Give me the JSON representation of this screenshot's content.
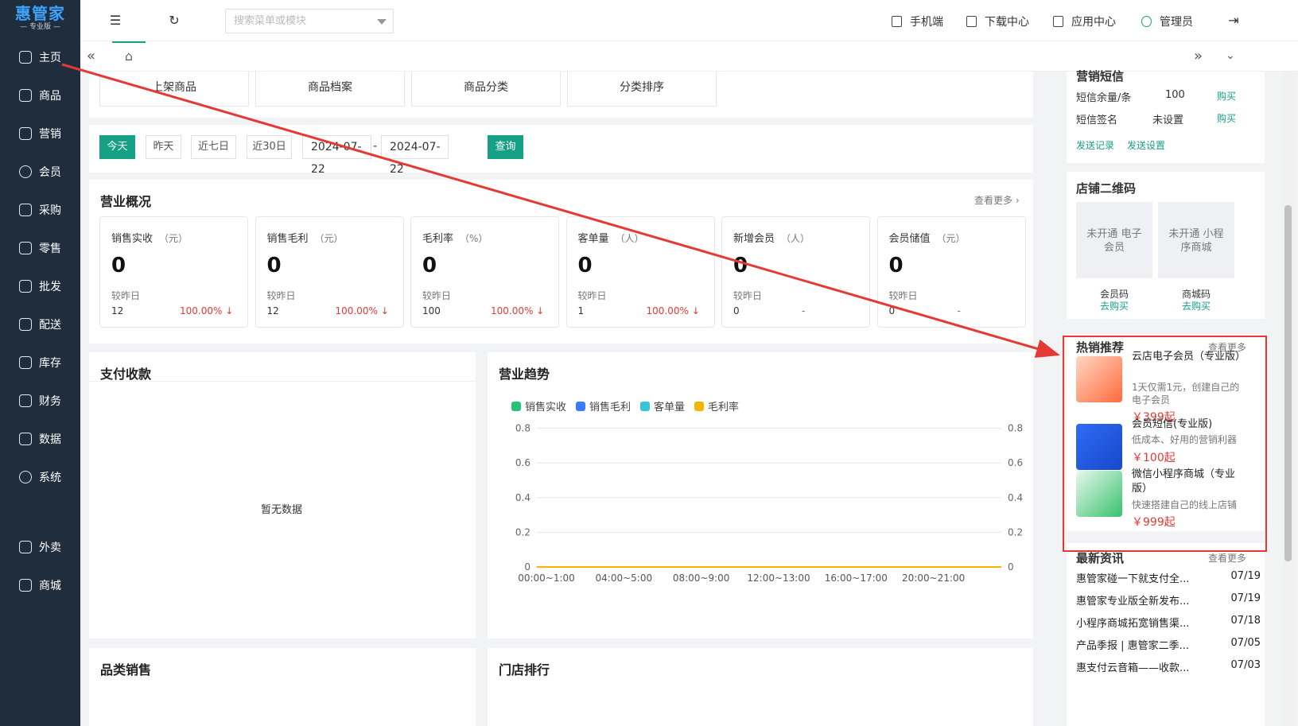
{
  "sidebar": {
    "logo_main": "惠管家",
    "logo_sub": "专业版",
    "items": [
      {
        "label": "主页",
        "icon": "home-icon"
      },
      {
        "label": "商品",
        "icon": "box-icon"
      },
      {
        "label": "营销",
        "icon": "chart-icon"
      },
      {
        "label": "会员",
        "icon": "diamond-icon"
      },
      {
        "label": "采购",
        "icon": "cart-icon"
      },
      {
        "label": "零售",
        "icon": "bag-icon"
      },
      {
        "label": "批发",
        "icon": "building-icon"
      },
      {
        "label": "配送",
        "icon": "truck-icon"
      },
      {
        "label": "库存",
        "icon": "inventory-icon"
      },
      {
        "label": "财务",
        "icon": "finance-icon"
      },
      {
        "label": "数据",
        "icon": "data-icon"
      },
      {
        "label": "系统",
        "icon": "settings-icon"
      },
      {
        "label": "外卖",
        "icon": "delivery-icon"
      },
      {
        "label": "商城",
        "icon": "store-icon"
      }
    ]
  },
  "topbar": {
    "search_placeholder": "搜索菜单或模块",
    "mobile": "手机端",
    "download": "下载中心",
    "apps": "应用中心",
    "user": "管理员"
  },
  "quick_buttons": [
    "上架商品",
    "商品档案",
    "商品分类",
    "分类排序"
  ],
  "filters": {
    "today": "今天",
    "yesterday": "昨天",
    "last7": "近七日",
    "last30": "近30日",
    "start_date": "2024-07-22",
    "separator": "-",
    "end_date": "2024-07-22",
    "query": "查询"
  },
  "overview": {
    "title": "营业概况",
    "more": "查看更多 ›",
    "compare_label": "较昨日",
    "stats": [
      {
        "name": "销售实收",
        "unit": "（元）",
        "value": "0",
        "yesterday": "12",
        "change": "100.00% ↓"
      },
      {
        "name": "销售毛利",
        "unit": "（元）",
        "value": "0",
        "yesterday": "12",
        "change": "100.00% ↓"
      },
      {
        "name": "毛利率",
        "unit": "（%）",
        "value": "0",
        "yesterday": "100",
        "change": "100.00% ↓"
      },
      {
        "name": "客单量",
        "unit": "（人）",
        "value": "0",
        "yesterday": "1",
        "change": "100.00% ↓"
      },
      {
        "name": "新增会员",
        "unit": "（人）",
        "value": "0",
        "yesterday": "0",
        "change": "-"
      },
      {
        "name": "会员储值",
        "unit": "（元）",
        "value": "0",
        "yesterday": "0",
        "change": "-"
      }
    ]
  },
  "payment": {
    "title": "支付收款",
    "empty": "暂无数据"
  },
  "trend": {
    "title": "营业趋势"
  },
  "category_sales": {
    "title": "品类销售"
  },
  "store_rank": {
    "title": "门店排行"
  },
  "chart_data": {
    "type": "line",
    "x": [
      "00:00~1:00",
      "04:00~5:00",
      "08:00~9:00",
      "12:00~13:00",
      "16:00~17:00",
      "20:00~21:00"
    ],
    "series": [
      {
        "name": "销售实收",
        "color": "#27c27a",
        "values": [
          0,
          0,
          0,
          0,
          0,
          0
        ]
      },
      {
        "name": "销售毛利",
        "color": "#3a7bff",
        "values": [
          0,
          0,
          0,
          0,
          0,
          0
        ]
      },
      {
        "name": "客单量",
        "color": "#36c4d8",
        "values": [
          0,
          0,
          0,
          0,
          0,
          0
        ]
      },
      {
        "name": "毛利率",
        "color": "#f5b400",
        "values": [
          0,
          0,
          0,
          0,
          0,
          0
        ]
      }
    ],
    "ylim": [
      0,
      1
    ],
    "yticks": [
      "1",
      "0.8",
      "0.6",
      "0.4",
      "0.2",
      "0"
    ],
    "legend": "top-left",
    "grid": true
  },
  "sms": {
    "title": "营销短信",
    "balance_label": "短信余量/条",
    "balance_value": "100",
    "buy": "购买",
    "sign_label": "短信签名",
    "sign_value": "未设置",
    "buy2": "购买",
    "records": "发送记录",
    "settings": "发送设置"
  },
  "qrcode": {
    "title": "店铺二维码",
    "items": [
      {
        "box": "未开通 电子会员",
        "caption": "会员码",
        "link": "去购买"
      },
      {
        "box": "未开通 小程序商城",
        "caption": "商城码",
        "link": "去购买"
      }
    ]
  },
  "hot": {
    "title": "热销推荐",
    "more": "查看更多",
    "products": [
      {
        "title": "云店电子会员（专业版）",
        "desc": "1天仅需1元，创建自己的电子会员",
        "price": "￥399起"
      },
      {
        "title": "会员短信(专业版)",
        "desc": "低成本、好用的营销利器",
        "price": "￥100起"
      },
      {
        "title": "微信小程序商城（专业版）",
        "desc": "快速搭建自己的线上店铺",
        "price": "￥999起"
      }
    ]
  },
  "news": {
    "title": "最新资讯",
    "more": "查看更多",
    "items": [
      {
        "text": "惠管家碰一下就支付全...",
        "date": "07/19"
      },
      {
        "text": "惠管家专业版全新发布...",
        "date": "07/19"
      },
      {
        "text": "小程序商城拓宽销售渠...",
        "date": "07/18"
      },
      {
        "text": "产品季报 | 惠管家二季...",
        "date": "07/05"
      },
      {
        "text": "惠支付云音箱——收款...",
        "date": "07/03"
      }
    ]
  },
  "colors": {
    "accent": "#16a085",
    "sidebar": "#1f2d3d",
    "annotation": "#e53935"
  }
}
